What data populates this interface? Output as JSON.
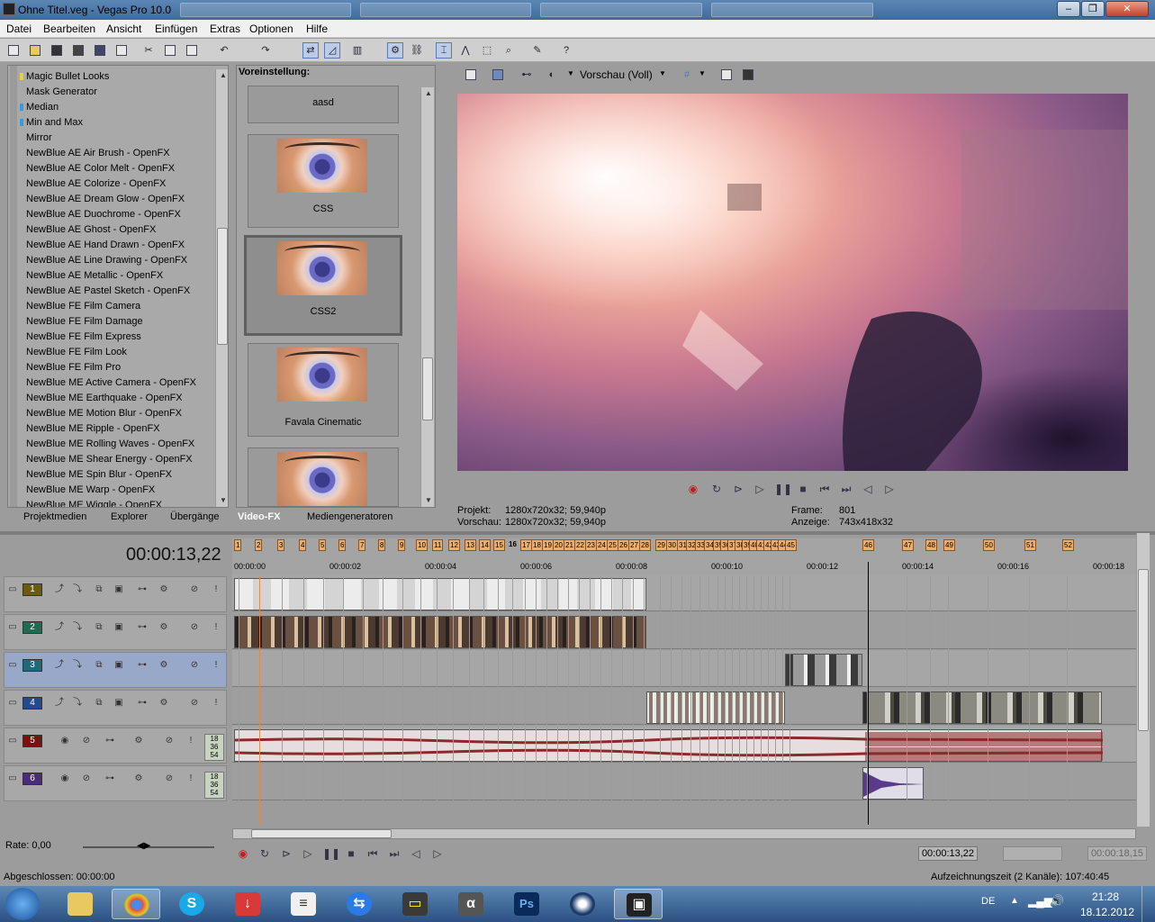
{
  "window": {
    "title": "Ohne Titel.veg - Vegas Pro 10.0",
    "min": "‒",
    "max": "❐",
    "close": "✕"
  },
  "menu": [
    "Datei",
    "Bearbeiten",
    "Ansicht",
    "Einfügen",
    "Extras",
    "Optionen",
    "Hilfe"
  ],
  "fx_list": [
    "Magic Bullet Looks",
    "Mask Generator",
    "Median",
    "Min and Max",
    "Mirror",
    "NewBlue AE Air Brush - OpenFX",
    "NewBlue AE Color Melt - OpenFX",
    "NewBlue AE Colorize - OpenFX",
    "NewBlue AE Dream Glow - OpenFX",
    "NewBlue AE Duochrome - OpenFX",
    "NewBlue AE Ghost - OpenFX",
    "NewBlue AE Hand Drawn - OpenFX",
    "NewBlue AE Line Drawing - OpenFX",
    "NewBlue AE Metallic - OpenFX",
    "NewBlue AE Pastel Sketch - OpenFX",
    "NewBlue FE Film Camera",
    "NewBlue FE Film Damage",
    "NewBlue FE Film Express",
    "NewBlue FE Film Look",
    "NewBlue FE Film Pro",
    "NewBlue ME Active Camera - OpenFX",
    "NewBlue ME Earthquake - OpenFX",
    "NewBlue ME Motion Blur - OpenFX",
    "NewBlue ME Ripple - OpenFX",
    "NewBlue ME Rolling Waves - OpenFX",
    "NewBlue ME Shear Energy - OpenFX",
    "NewBlue ME Spin Blur - OpenFX",
    "NewBlue ME Warp - OpenFX",
    "NewBlue ME Wiggle - OpenFX"
  ],
  "presets": {
    "header": "Voreinstellung:",
    "items": [
      "aasd",
      "CSS",
      "CSS2",
      "Favala Cinematic"
    ],
    "selected": "CSS2"
  },
  "tabs": {
    "items": [
      "Projektmedien",
      "Explorer",
      "Übergänge",
      "Video-FX",
      "Mediengeneratoren"
    ],
    "active": "Video-FX"
  },
  "preview": {
    "mode": "Vorschau (Voll)",
    "projekt_label": "Projekt:",
    "projekt": "1280x720x32; 59,940p",
    "vorschau_label": "Vorschau:",
    "vorschau": "1280x720x32; 59,940p",
    "frame_label": "Frame:",
    "frame": "801",
    "anzeige_label": "Anzeige:",
    "anzeige": "743x418x32"
  },
  "timeline": {
    "timecode": "00:00:13,22",
    "ruler_ticks": [
      "00:00:00",
      "00:00:02",
      "00:00:04",
      "00:00:06",
      "00:00:08",
      "00:00:10",
      "00:00:12",
      "00:00:14",
      "00:00:16",
      "00:00:18"
    ],
    "markers": [
      "1",
      "2",
      "3",
      "4",
      "5",
      "6",
      "7",
      "8",
      "9",
      "10",
      "11",
      "12",
      "13",
      "14",
      "15",
      "16",
      "17",
      "18",
      "19",
      "20",
      "21",
      "22",
      "23",
      "24",
      "25",
      "26",
      "27",
      "28",
      "29",
      "30",
      "31",
      "32",
      "33",
      "34",
      "35",
      "36",
      "37",
      "38",
      "39",
      "40",
      "41",
      "42",
      "43",
      "44",
      "45",
      "46",
      "47",
      "48",
      "49",
      "50",
      "51",
      "52",
      "53",
      "54",
      "55",
      "56"
    ],
    "tracks": [
      {
        "num": "1",
        "type": "video",
        "color": "#6b5a10"
      },
      {
        "num": "2",
        "type": "video",
        "color": "#1f6a50"
      },
      {
        "num": "3",
        "type": "video",
        "color": "#1f6a78"
      },
      {
        "num": "4",
        "type": "video",
        "color": "#234a8c"
      },
      {
        "num": "5",
        "type": "audio",
        "color": "#7a1010"
      },
      {
        "num": "6",
        "type": "audio",
        "color": "#4a2a7a"
      }
    ],
    "audio_meter": [
      "18",
      "36",
      "54"
    ],
    "rate": "Rate: 0,00",
    "cursor_time": "00:00:13,22",
    "end_time": "00:00:18,15"
  },
  "status": {
    "left": "Abgeschlossen: 00:00:00",
    "right": "Aufzeichnungszeit (2 Kanäle): 107:40:45"
  },
  "taskbar": {
    "lang": "DE",
    "time": "21:28",
    "date": "18.12.2012"
  }
}
